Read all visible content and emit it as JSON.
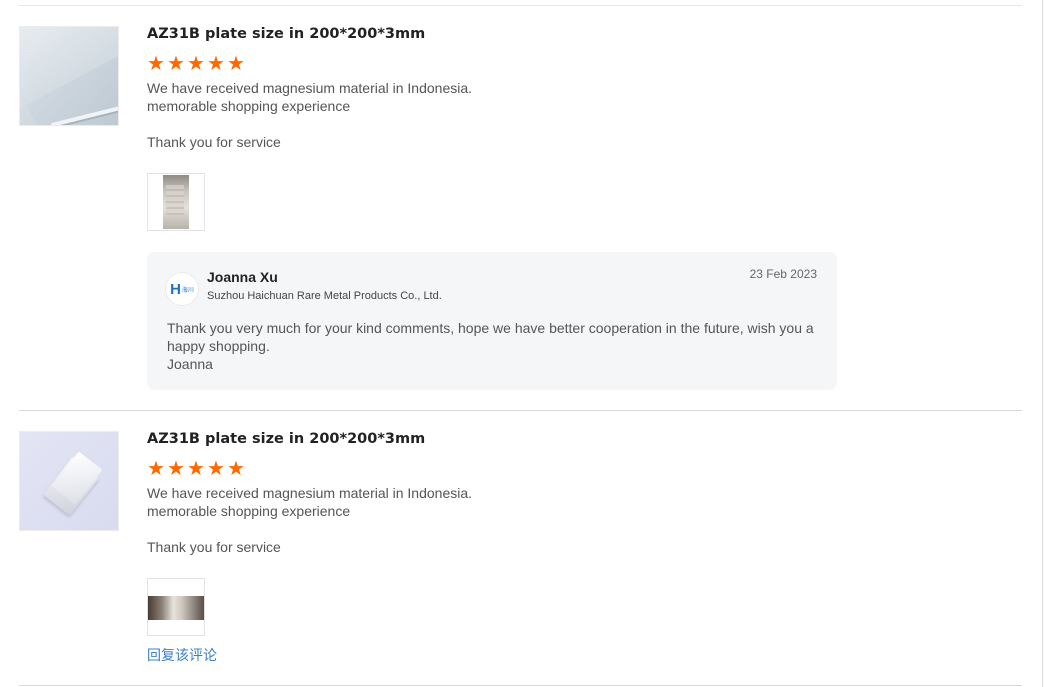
{
  "reviews": [
    {
      "product_title": "AZ31B plate size in 200*200*3mm",
      "rating": 5,
      "text_lines": [
        "We have received magnesium material in Indonesia.",
        "memorable shopping experience",
        "",
        "Thank you for service"
      ],
      "reply": {
        "name": "Joanna Xu",
        "company": "Suzhou Haichuan Rare Metal Products Co., Ltd.",
        "date": "23 Feb 2023",
        "logo_letter": "H",
        "logo_small": "海川",
        "text": "Thank you very much for your kind comments, hope we have better cooperation in the future, wish you a happy shopping.",
        "signature": "Joanna"
      }
    },
    {
      "product_title": "AZ31B plate size in 200*200*3mm",
      "rating": 5,
      "text_lines": [
        "We have received magnesium material in Indonesia.",
        "memorable shopping experience",
        "",
        "Thank you for service"
      ],
      "reply_link_label": "回复该评论"
    }
  ],
  "colors": {
    "star": "#ff6a00",
    "link": "#3b80c8",
    "reply_bg": "#f5f6f8"
  },
  "icons": {
    "star": "star-icon"
  }
}
